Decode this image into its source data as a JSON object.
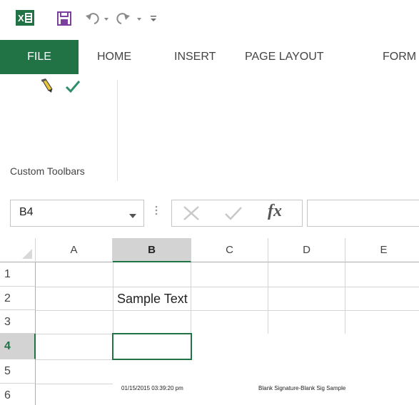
{
  "qat": {
    "icons": [
      "excel-logo",
      "save-icon",
      "undo-icon",
      "redo-icon",
      "customize-qat-icon"
    ],
    "excel_logo_text": "X",
    "colors": {
      "excel_green": "#217346",
      "save_purple": "#7b3f9e"
    }
  },
  "tabs": [
    {
      "label": "FILE",
      "active": true
    },
    {
      "label": "HOME"
    },
    {
      "label": "INSERT"
    },
    {
      "label": "PAGE LAYOUT"
    },
    {
      "label": "FORM"
    }
  ],
  "ribbon": {
    "group_label": "Custom Toolbars",
    "icons": [
      "pencil-icon",
      "checkmark-icon"
    ]
  },
  "formula_bar": {
    "name_box_value": "B4",
    "fx_label": "fx",
    "formula_value": ""
  },
  "sheet": {
    "columns": [
      "A",
      "B",
      "C",
      "D",
      "E"
    ],
    "rows": [
      "1",
      "2",
      "3",
      "4",
      "5",
      "6"
    ],
    "active_cell": "B4",
    "cells": {
      "B2": "Sample Text"
    },
    "signature": {
      "date": "01/15/2015 03:39:20 pm",
      "text": "Blank Signature-Blank Sig Sample"
    }
  }
}
